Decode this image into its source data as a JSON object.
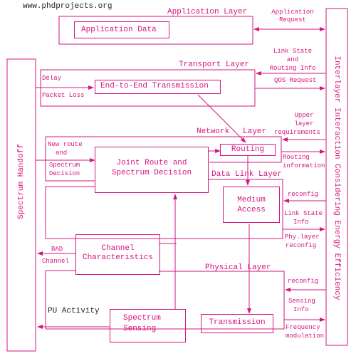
{
  "watermark": "www.phdprojects.org",
  "colors": {
    "accent": "#d6157f",
    "text_dark": "#222222",
    "background": "#ffffff"
  },
  "side_panels": {
    "left": "Spectrum Handoff",
    "right": "Interlayer Interaction Considering Energy Efficiency"
  },
  "layers": {
    "application": "Application Layer",
    "transport": "Transport Layer",
    "network": "Network Layer",
    "network_word1": "Network",
    "network_word2": "Layer",
    "data_link": "Data Link Layer",
    "physical": "Physical Layer"
  },
  "blocks": {
    "application_data": "Application Data",
    "end_to_end": "End-to-End Transmission",
    "routing": "Routing",
    "joint_route_1": "Joint Route and",
    "joint_route_2": "Spectrum Decision",
    "medium_access_1": "Medium",
    "medium_access_2": "Access",
    "channel_char_1": "Channel",
    "channel_char_2": "Characteristics",
    "spectrum_sensing_1": "Spectrum",
    "spectrum_sensing_2": "Sensing",
    "transmission": "Transmission"
  },
  "labels": {
    "application_request_1": "Application",
    "application_request_2": "Request",
    "link_state_routing_1": "Link State",
    "link_state_routing_2": "and",
    "link_state_routing_3": "Routing Info",
    "qos_request": "QOS Request",
    "delay": "Delay",
    "packet_loss": "Packet Loss",
    "upper_layer_1": "Upper",
    "upper_layer_2": "layer",
    "upper_layer_3": "requirements",
    "new_route_1": "New route",
    "new_route_2": "and",
    "new_route_3": "Spectrum",
    "new_route_4": "Decision",
    "routing_info_1": "Routing",
    "routing_info_2": "information",
    "reconfig_dl": "reconfig",
    "link_state_info_1": "Link State",
    "link_state_info_2": "Info",
    "phy_reconfig_1": "Phy.layer",
    "phy_reconfig_2": "reconfig",
    "bad_channel_1": "BAD",
    "bad_channel_2": "Channel",
    "pu_activity": "PU Activity",
    "reconfig_phy": "reconfig",
    "sensing_info_1": "Sensing",
    "sensing_info_2": "Info",
    "freq_mod_1": "Frequency",
    "freq_mod_2": "modulation"
  }
}
